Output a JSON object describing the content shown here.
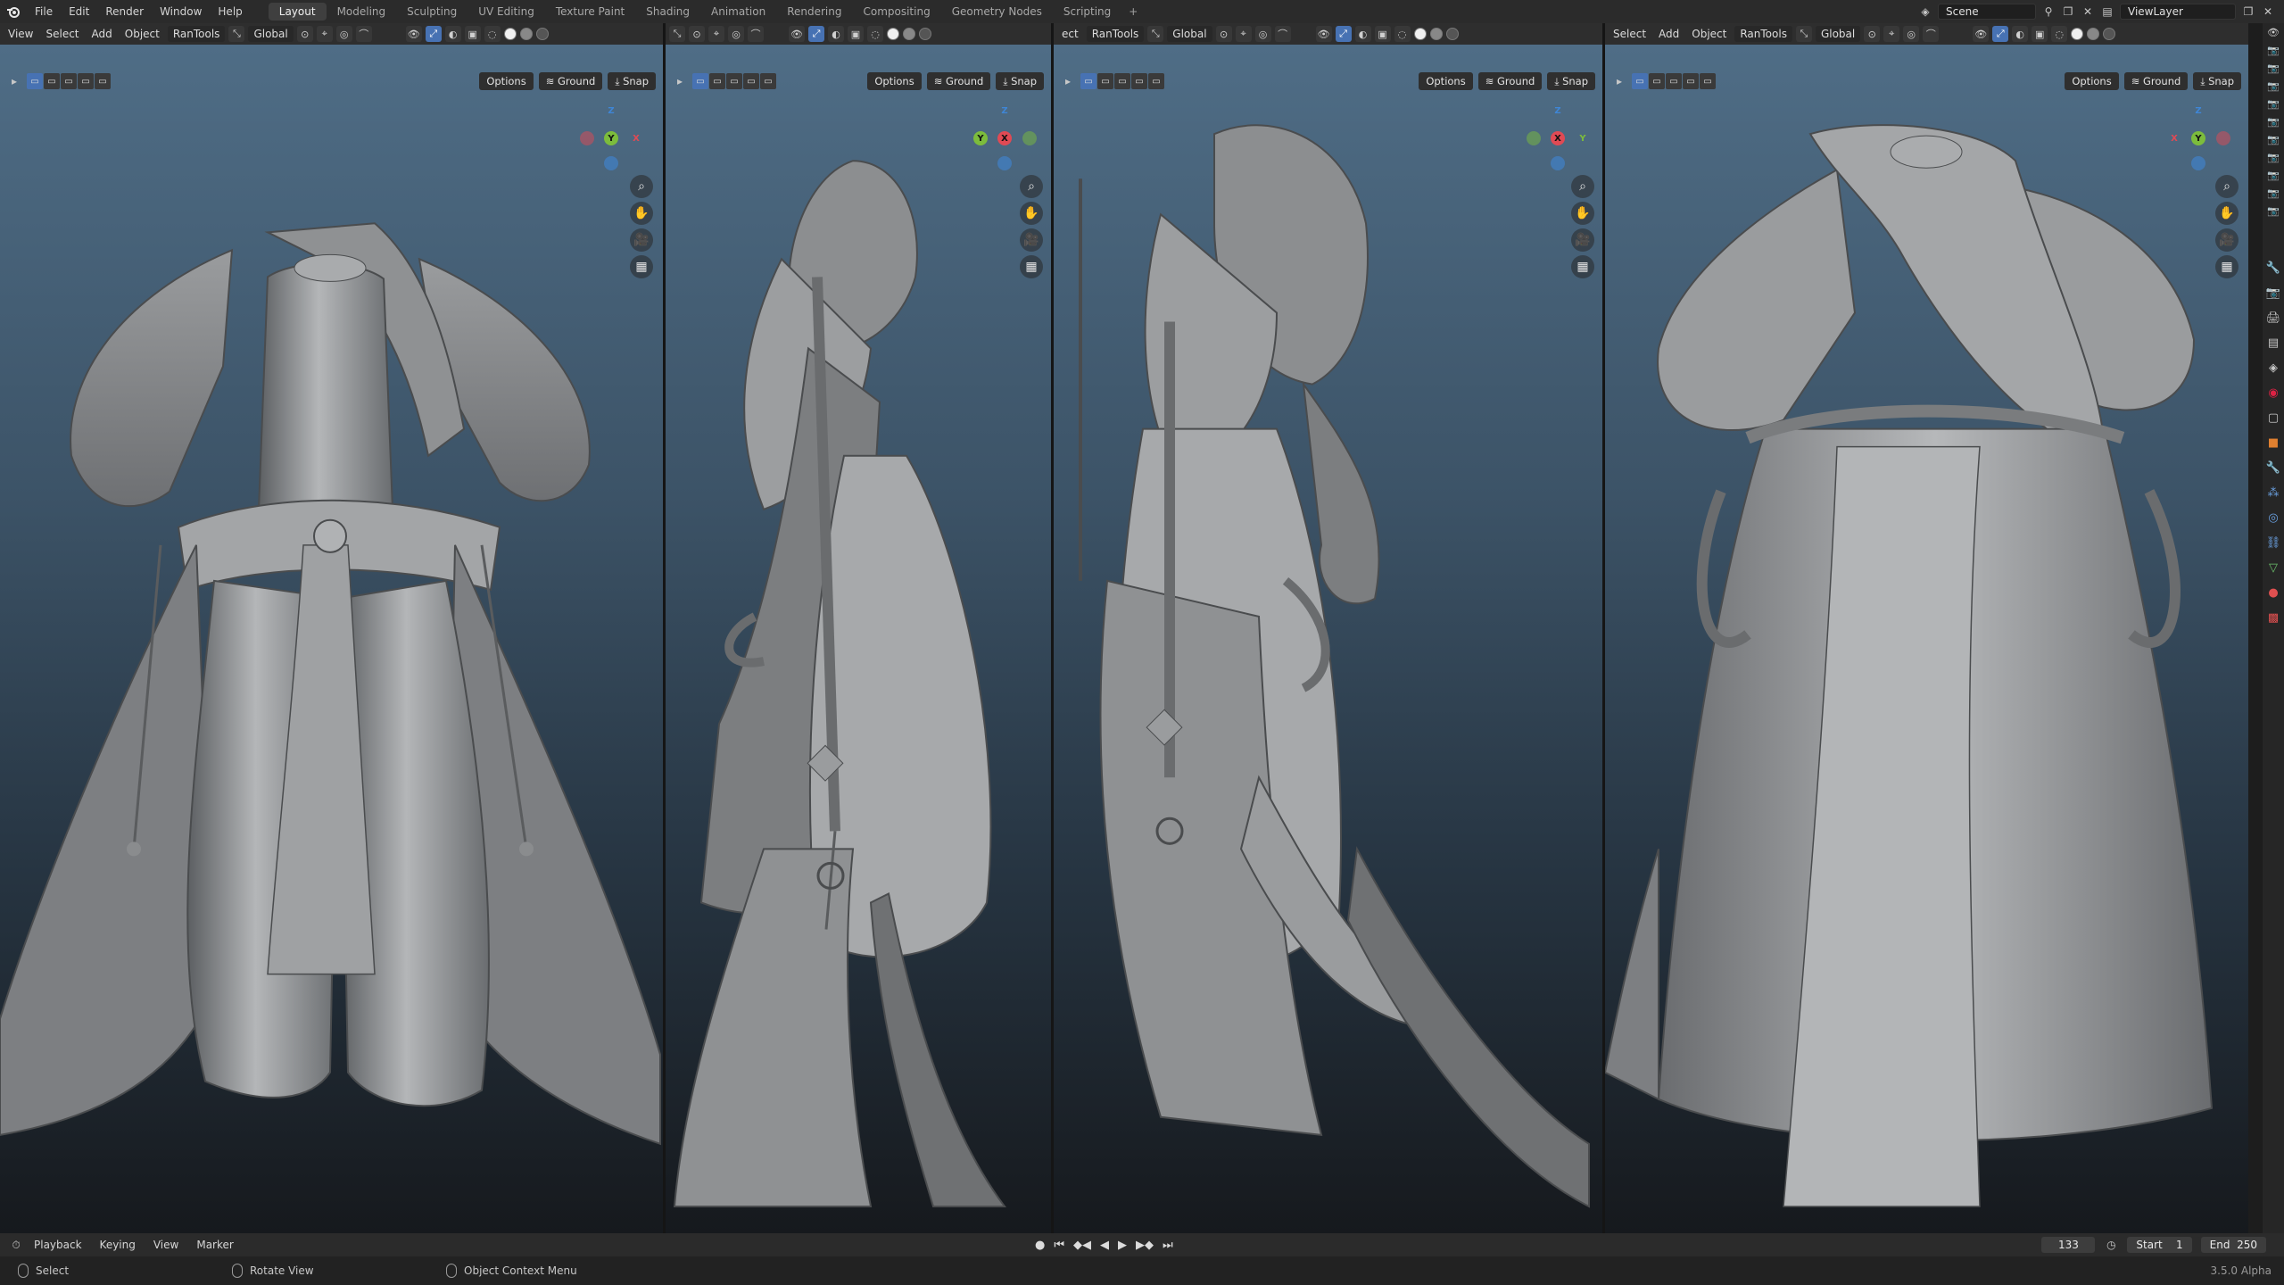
{
  "topbar": {
    "menus": [
      "File",
      "Edit",
      "Render",
      "Window",
      "Help"
    ],
    "workspaces": [
      "Layout",
      "Modeling",
      "Sculpting",
      "UV Editing",
      "Texture Paint",
      "Shading",
      "Animation",
      "Rendering",
      "Compositing",
      "Geometry Nodes",
      "Scripting"
    ],
    "active_workspace": "Layout",
    "add_tab": "+",
    "scene": "Scene",
    "view_layer": "ViewLayer"
  },
  "viewports": [
    {
      "menus": [
        "View",
        "Select",
        "Add",
        "Object"
      ],
      "addon": "RanTools",
      "orientation": "Global",
      "options": "Options",
      "ground": "Ground",
      "snap": "Snap",
      "gizmo": {
        "left": "Y",
        "center": "Y",
        "right": "X",
        "top": "Z"
      }
    },
    {
      "menus": [],
      "addon": "",
      "orientation": "",
      "options": "Options",
      "ground": "Ground",
      "snap": "Snap",
      "gizmo": {
        "left": "Y",
        "center": "X",
        "right": "",
        "top": "Z"
      }
    },
    {
      "menus": [
        "ect"
      ],
      "addon": "RanTools",
      "orientation": "Global",
      "options": "Options",
      "ground": "Ground",
      "snap": "Snap",
      "gizmo": {
        "left": "",
        "center": "X",
        "right": "Y",
        "top": "Z"
      }
    },
    {
      "menus": [
        "Select",
        "Add",
        "Object"
      ],
      "addon": "RanTools",
      "orientation": "Global",
      "options": "Options",
      "ground": "Ground",
      "snap": "Snap",
      "gizmo": {
        "left": "X",
        "center": "Y",
        "right": "",
        "top": "Z"
      }
    }
  ],
  "timeline": {
    "menus": [
      "Playback",
      "Keying",
      "View",
      "Marker"
    ],
    "current_frame": "133",
    "start_label": "Start",
    "start": "1",
    "end_label": "End",
    "end": "250"
  },
  "status": {
    "select": "Select",
    "rotate": "Rotate View",
    "context": "Object Context Menu",
    "version": "3.5.0 Alpha"
  },
  "colors": {
    "axis_x": "#e04a54",
    "axis_y": "#7cbc3c",
    "axis_z": "#3f86d6",
    "accent": "#4772b3"
  }
}
